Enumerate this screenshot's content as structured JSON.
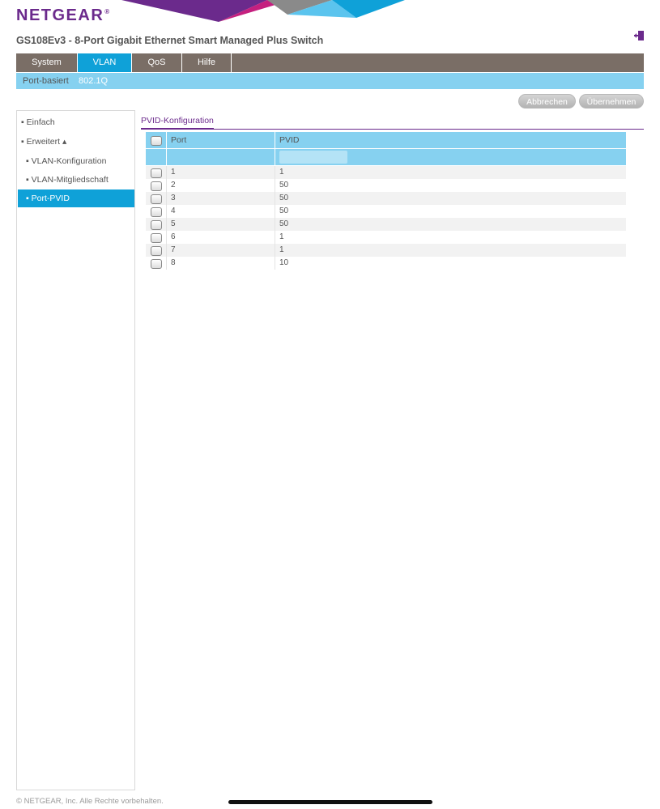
{
  "brand": {
    "logo_text": "NETGEAR",
    "logo_mark": "®"
  },
  "header": {
    "device_title": "GS108Ev3 - 8-Port Gigabit Ethernet Smart Managed Plus Switch",
    "logout_icon": "logout-icon"
  },
  "topnav": {
    "tabs": [
      {
        "label": "System"
      },
      {
        "label": "VLAN"
      },
      {
        "label": "QoS"
      },
      {
        "label": "Hilfe"
      }
    ],
    "active": "VLAN"
  },
  "subnav": {
    "items": [
      {
        "label": "Port-basiert"
      },
      {
        "label": "802.1Q"
      }
    ],
    "active": "802.1Q"
  },
  "actions": {
    "cancel_label": "Abbrechen",
    "apply_label": "Übernehmen"
  },
  "sidebar": {
    "items": [
      {
        "label": "▪ Einfach"
      },
      {
        "label": "▪ Erweitert ▴"
      },
      {
        "label": "▪ VLAN-Konfiguration"
      },
      {
        "label": "▪ VLAN-Mitgliedschaft"
      },
      {
        "label": "▪ Port-PVID"
      }
    ],
    "active": "Port-PVID"
  },
  "section": {
    "title": "PVID-Konfiguration"
  },
  "table": {
    "columns": {
      "port": "Port",
      "pvid": "PVID"
    },
    "filter_value": "",
    "rows": [
      {
        "port": "1",
        "pvid": "1"
      },
      {
        "port": "2",
        "pvid": "50"
      },
      {
        "port": "3",
        "pvid": "50"
      },
      {
        "port": "4",
        "pvid": "50"
      },
      {
        "port": "5",
        "pvid": "50"
      },
      {
        "port": "6",
        "pvid": "1"
      },
      {
        "port": "7",
        "pvid": "1"
      },
      {
        "port": "8",
        "pvid": "10"
      }
    ]
  },
  "footer": {
    "copyright": "© NETGEAR, Inc. Alle Rechte vorbehalten."
  },
  "colors": {
    "brand_purple": "#6b2a8c",
    "accent_blue": "#0fa1d8",
    "light_blue": "#86d1f0",
    "nav_gray": "#7a6e66"
  }
}
